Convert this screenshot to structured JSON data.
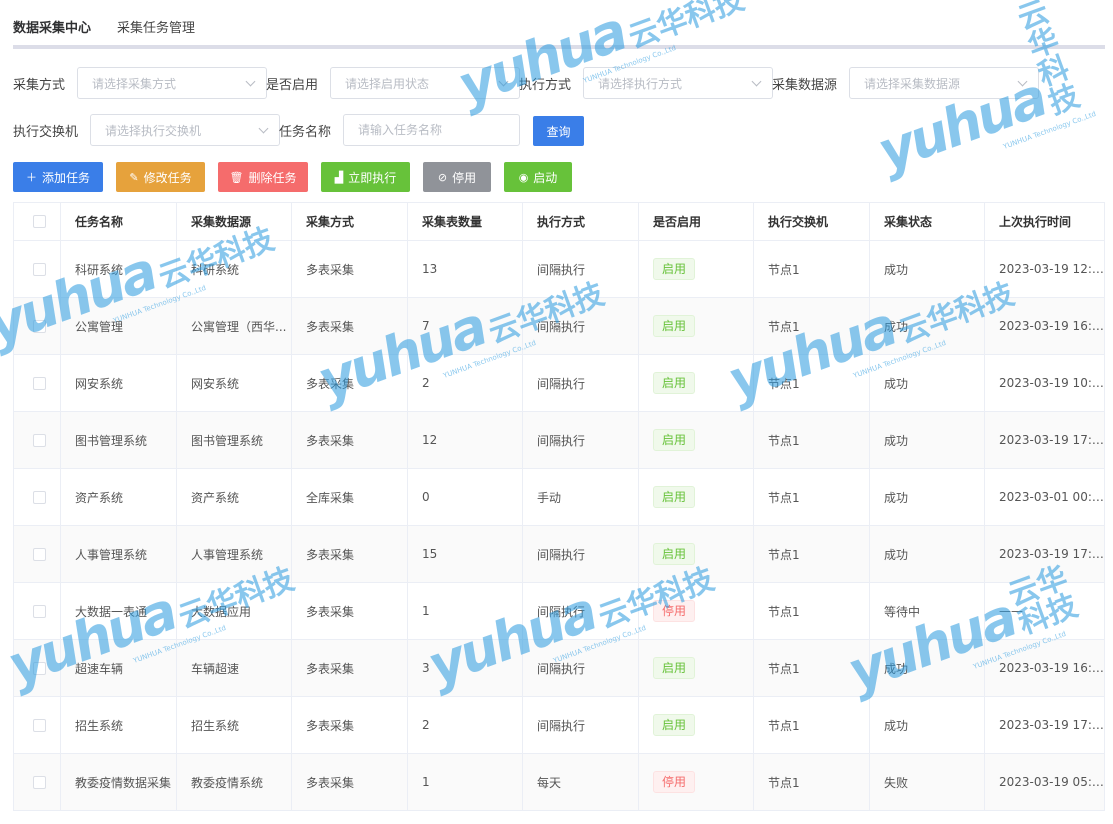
{
  "breadcrumb": {
    "main": "数据采集中心",
    "sub": "采集任务管理"
  },
  "filters": {
    "method_label": "采集方式",
    "method_placeholder": "请选择采集方式",
    "enabled_label": "是否启用",
    "enabled_placeholder": "请选择启用状态",
    "exec_label": "执行方式",
    "exec_placeholder": "请选择执行方式",
    "source_label": "采集数据源",
    "source_placeholder": "请选择采集数据源",
    "switch_label": "执行交换机",
    "switch_placeholder": "请选择执行交换机",
    "name_label": "任务名称",
    "name_placeholder": "请输入任务名称",
    "query_button": "查询"
  },
  "toolbar": {
    "add": "添加任务",
    "edit": "修改任务",
    "delete": "删除任务",
    "run_now": "立即执行",
    "disable": "停用",
    "enable": "启动"
  },
  "colors": {
    "add": "#3a7ee8",
    "edit": "#e6a23c",
    "delete": "#f56c6c",
    "run_now": "#67c23a",
    "disable": "#909399",
    "enable": "#67c23a",
    "query": "#3a7ee8"
  },
  "table": {
    "columns": [
      "任务名称",
      "采集数据源",
      "采集方式",
      "采集表数量",
      "执行方式",
      "是否启用",
      "执行交换机",
      "采集状态",
      "上次执行时间"
    ],
    "rows": [
      [
        "科研系统",
        "科研系统",
        "多表采集",
        "13",
        "间隔执行",
        "启用",
        "节点1",
        "成功",
        "2023-03-19 12:4..."
      ],
      [
        "公寓管理",
        "公寓管理（西华...",
        "多表采集",
        "7",
        "间隔执行",
        "启用",
        "节点1",
        "成功",
        "2023-03-19 16:0..."
      ],
      [
        "网安系统",
        "网安系统",
        "多表采集",
        "2",
        "间隔执行",
        "启用",
        "节点1",
        "成功",
        "2023-03-19 10:0..."
      ],
      [
        "图书管理系统",
        "图书管理系统",
        "多表采集",
        "12",
        "间隔执行",
        "启用",
        "节点1",
        "成功",
        "2023-03-19 17:4..."
      ],
      [
        "资产系统",
        "资产系统",
        "全库采集",
        "0",
        "手动",
        "启用",
        "节点1",
        "成功",
        "2023-03-01 00:1..."
      ],
      [
        "人事管理系统",
        "人事管理系统",
        "多表采集",
        "15",
        "间隔执行",
        "启用",
        "节点1",
        "成功",
        "2023-03-19 17:2..."
      ],
      [
        "大数据一表通",
        "大数据应用",
        "多表采集",
        "1",
        "间隔执行",
        "停用",
        "节点1",
        "等待中",
        "——"
      ],
      [
        "超速车辆",
        "车辆超速",
        "多表采集",
        "3",
        "间隔执行",
        "启用",
        "节点1",
        "成功",
        "2023-03-19 16:5..."
      ],
      [
        "招生系统",
        "招生系统",
        "多表采集",
        "2",
        "间隔执行",
        "启用",
        "节点1",
        "成功",
        "2023-03-19 17:2..."
      ],
      [
        "教委疫情数据采集",
        "教委疫情系统",
        "多表采集",
        "1",
        "每天",
        "停用",
        "节点1",
        "失败",
        "2023-03-19 05:0..."
      ]
    ]
  },
  "watermark": {
    "logo": "yuhua",
    "cn": "云华科技",
    "en": "YUNHUA Technology Co.,Ltd"
  }
}
